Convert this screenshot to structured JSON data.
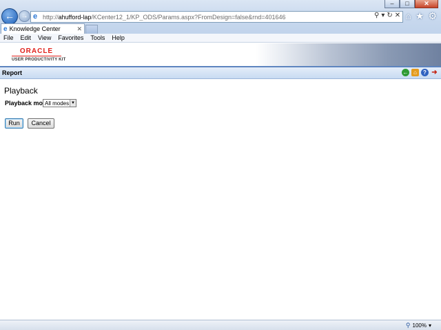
{
  "browser": {
    "url_prefix": "http://",
    "url_host": "ahufford-lap",
    "url_path": "/KCenter12_1/KP_ODS/Params.aspx?FromDesign=false&rnd=401646",
    "tab_title": "Knowledge Center",
    "window_buttons": {
      "minimize": "–",
      "maximize": "□",
      "close": "✕"
    },
    "addr_tools": {
      "search": "⚲",
      "dropdown": "▾",
      "refresh": "↻",
      "stop": "✕"
    },
    "toolbar_icons": {
      "home": "⌂",
      "favorites": "★",
      "tools": "⚙"
    },
    "menu": [
      "File",
      "Edit",
      "View",
      "Favorites",
      "Tools",
      "Help"
    ],
    "zoom": "100%"
  },
  "banner": {
    "logo_oracle": "ORACLE",
    "logo_subtitle": "USER PRODUCTIVITY KIT"
  },
  "report_bar": {
    "title": "Report",
    "icons": [
      "back-icon",
      "home-icon",
      "help-icon",
      "exit-icon"
    ]
  },
  "form": {
    "heading": "Playback",
    "mode_label": "Playback mode",
    "mode_value": "All modes",
    "run_label": "Run",
    "cancel_label": "Cancel"
  }
}
